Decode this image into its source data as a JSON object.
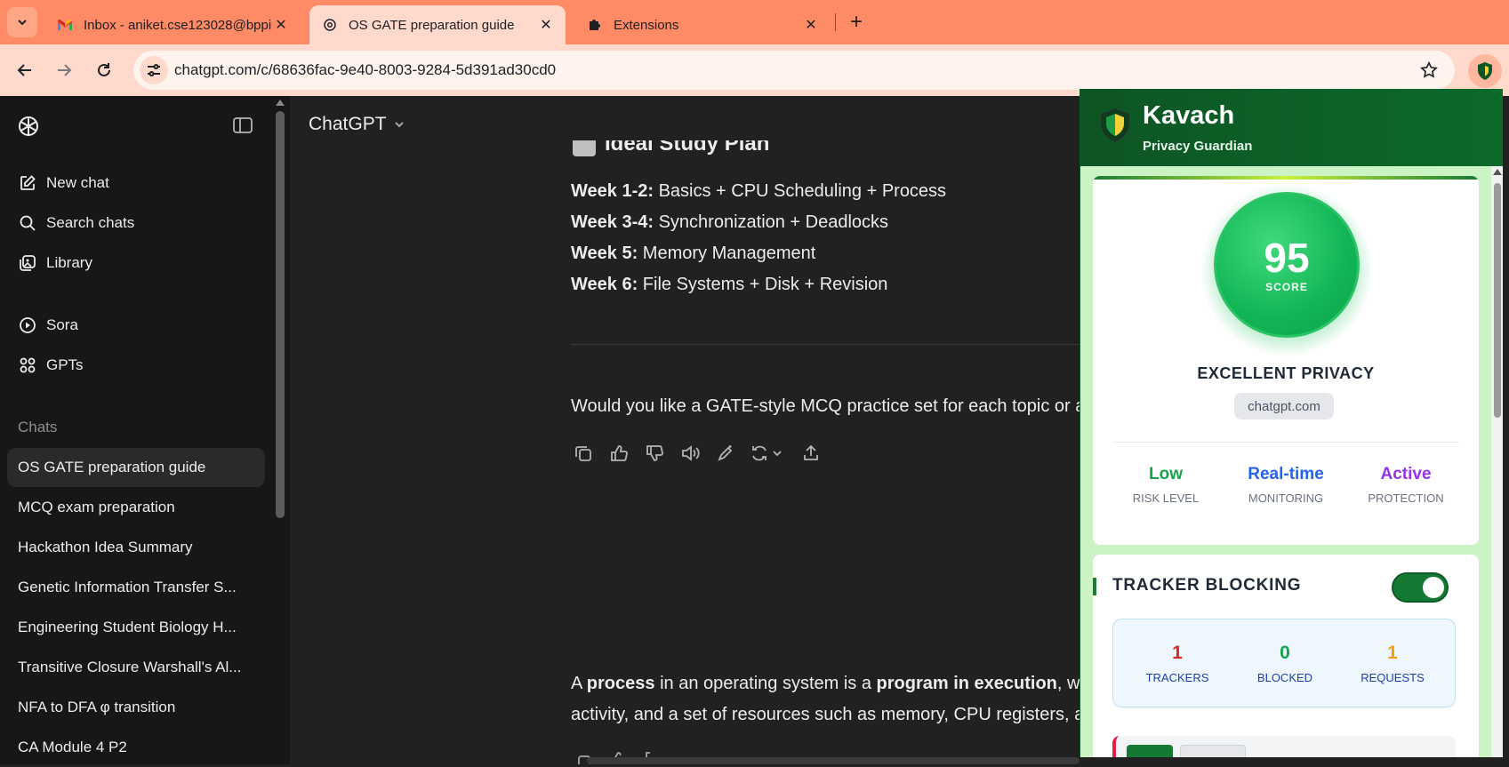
{
  "browser": {
    "tabs": [
      {
        "title": "Inbox - aniket.cse123028@bppi",
        "favicon": "gmail-icon",
        "active": false
      },
      {
        "title": "OS GATE preparation guide",
        "favicon": "chatgpt-icon",
        "active": true
      },
      {
        "title": "Extensions",
        "favicon": "puzzle-icon",
        "active": false
      }
    ],
    "url": "chatgpt.com/c/68636fac-9e40-8003-9284-5d391ad30cd0",
    "theme_color": "#ff8a66"
  },
  "sidebar": {
    "nav": [
      {
        "label": "New chat",
        "icon": "edit-icon"
      },
      {
        "label": "Search chats",
        "icon": "search-icon"
      },
      {
        "label": "Library",
        "icon": "library-icon"
      },
      {
        "label": "Sora",
        "icon": "play-icon"
      },
      {
        "label": "GPTs",
        "icon": "grid-icon"
      }
    ],
    "chats_heading": "Chats",
    "chats": [
      "OS GATE preparation guide",
      "MCQ exam preparation",
      "Hackathon Idea Summary",
      "Genetic Information Transfer S...",
      "Engineering Student Biology H...",
      "Transitive Closure Warshall's Al...",
      "NFA to DFA φ transition",
      "CA Module 4 P2"
    ]
  },
  "main": {
    "model": "ChatGPT",
    "plan_heading": "Ideal Study Plan",
    "weeks": [
      {
        "label": "Week 1-2:",
        "text": " Basics + CPU Scheduling + Process"
      },
      {
        "label": "Week 3-4:",
        "text": " Synchronization + Deadlocks"
      },
      {
        "label": "Week 5:",
        "text": " Memory Management"
      },
      {
        "label": "Week 6:",
        "text": " File Systems + Disk + Revision"
      }
    ],
    "question": "Would you like a GATE-style MCQ practice set for each topic or a",
    "answer": {
      "l1_a": "A ",
      "l1_b": "process",
      "l1_c": " in an operating system is a ",
      "l1_d": "program in execution",
      "l1_e": ", whic",
      "l2": "activity, and a set of resources such as memory, CPU registers, an"
    },
    "actions": [
      "copy-icon",
      "thumbs-up-icon",
      "thumbs-down-icon",
      "read-aloud-icon",
      "edit-canvas-icon",
      "regenerate-icon",
      "share-icon"
    ]
  },
  "kavach": {
    "title": "Kavach",
    "subtitle": "Privacy Guardian",
    "score": "95",
    "score_label": "SCORE",
    "privacy_level": "EXCELLENT PRIVACY",
    "domain": "chatgpt.com",
    "stats": [
      {
        "value": "Low",
        "label": "RISK LEVEL",
        "color": "#16a34a"
      },
      {
        "value": "Real-time",
        "label": "MONITORING",
        "color": "#2563eb"
      },
      {
        "value": "Active",
        "label": "PROTECTION",
        "color": "#9333ea"
      }
    ],
    "tracker_blocking": {
      "title": "TRACKER BLOCKING",
      "enabled": true,
      "stats": [
        {
          "value": "1",
          "label": "TRACKERS",
          "color": "#dc2626"
        },
        {
          "value": "0",
          "label": "BLOCKED",
          "color": "#16a34a"
        },
        {
          "value": "1",
          "label": "REQUESTS",
          "color": "#f59e0b"
        }
      ]
    },
    "colors": {
      "header": "#0d5524",
      "score": "#11b556",
      "background": "#ccf3c4"
    }
  }
}
